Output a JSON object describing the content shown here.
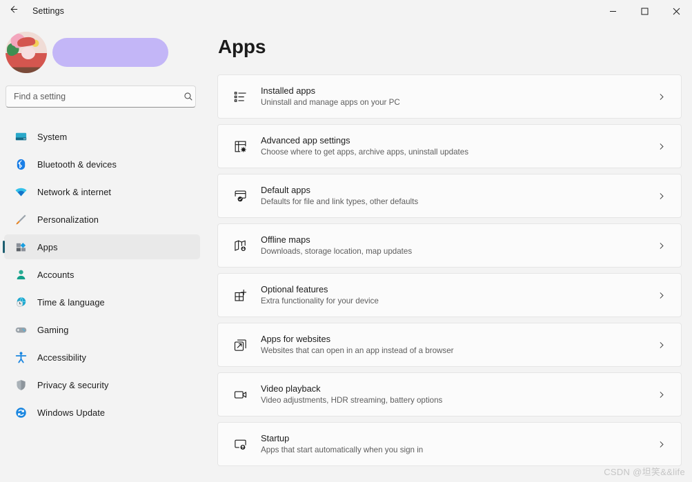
{
  "titlebar": {
    "back_icon": "arrow-left-icon",
    "title": "Settings",
    "minimize_label": "—",
    "maximize_label": "□",
    "close_label": "✕"
  },
  "sidebar": {
    "account": {
      "avatar_icon": "user-avatar",
      "name_redacted": "",
      "redaction_color": "#c3b6f7"
    },
    "search": {
      "placeholder": "Find a setting",
      "value": "",
      "icon": "search-icon"
    },
    "items": [
      {
        "label": "System",
        "icon": "system-monitor-icon",
        "selected": false
      },
      {
        "label": "Bluetooth & devices",
        "icon": "bluetooth-icon",
        "selected": false
      },
      {
        "label": "Network & internet",
        "icon": "wifi-icon",
        "selected": false
      },
      {
        "label": "Personalization",
        "icon": "paintbrush-icon",
        "selected": false
      },
      {
        "label": "Apps",
        "icon": "apps-grid-icon",
        "selected": true
      },
      {
        "label": "Accounts",
        "icon": "person-icon",
        "selected": false
      },
      {
        "label": "Time & language",
        "icon": "clock-globe-icon",
        "selected": false
      },
      {
        "label": "Gaming",
        "icon": "gamepad-icon",
        "selected": false
      },
      {
        "label": "Accessibility",
        "icon": "accessibility-person-icon",
        "selected": false
      },
      {
        "label": "Privacy & security",
        "icon": "shield-icon",
        "selected": false
      },
      {
        "label": "Windows Update",
        "icon": "refresh-circle-icon",
        "selected": false
      }
    ]
  },
  "main": {
    "page_title": "Apps",
    "chevron_icon": "chevron-right-icon",
    "cards": [
      {
        "title": "Installed apps",
        "subtitle": "Uninstall and manage apps on your PC",
        "icon": "bullet-list-icon"
      },
      {
        "title": "Advanced app settings",
        "subtitle": "Choose where to get apps, archive apps, uninstall updates",
        "icon": "app-gear-icon"
      },
      {
        "title": "Default apps",
        "subtitle": "Defaults for file and link types, other defaults",
        "icon": "window-check-icon"
      },
      {
        "title": "Offline maps",
        "subtitle": "Downloads, storage location, map updates",
        "icon": "map-download-icon"
      },
      {
        "title": "Optional features",
        "subtitle": "Extra functionality for your device",
        "icon": "grid-plus-icon"
      },
      {
        "title": "Apps for websites",
        "subtitle": "Websites that can open in an app instead of a browser",
        "icon": "external-link-icon"
      },
      {
        "title": "Video playback",
        "subtitle": "Video adjustments, HDR streaming, battery options",
        "icon": "video-camera-icon"
      },
      {
        "title": "Startup",
        "subtitle": "Apps that start automatically when you sign in",
        "icon": "startup-arrow-icon"
      }
    ]
  },
  "watermark": {
    "text": "CSDN @坦笑&&life"
  },
  "colors": {
    "background": "#f3f3f3",
    "card": "#fbfbfb",
    "accent": "#1d5e70",
    "selected_row": "#e9e9e9",
    "text_primary": "#1b1b1b",
    "text_secondary": "#5d5d5d"
  }
}
